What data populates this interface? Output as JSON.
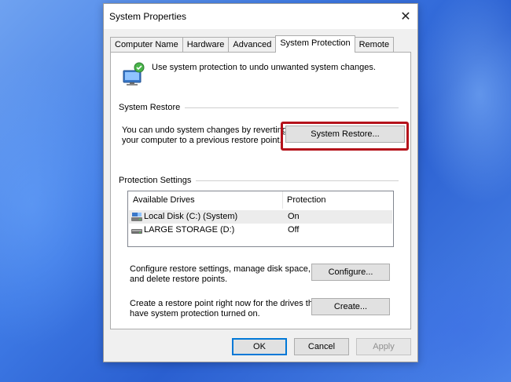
{
  "window": {
    "title": "System Properties",
    "close_glyph": "✕"
  },
  "tabs": [
    {
      "label": "Computer Name"
    },
    {
      "label": "Hardware"
    },
    {
      "label": "Advanced"
    },
    {
      "label": "System Protection",
      "active": true
    },
    {
      "label": "Remote"
    }
  ],
  "intro": {
    "icon": "system-protection-icon",
    "text": "Use system protection to undo unwanted system changes."
  },
  "system_restore": {
    "header": "System Restore",
    "description_line1": "You can undo system changes by reverting",
    "description_line2": "your computer to a previous restore point.",
    "button_label": "System Restore...",
    "highlight_color": "#b5121b"
  },
  "protection_settings": {
    "header": "Protection Settings",
    "columns": [
      "Available Drives",
      "Protection"
    ],
    "drives": [
      {
        "name": "Local Disk (C:) (System)",
        "protection": "On",
        "icon": "system-drive-icon",
        "selected": true
      },
      {
        "name": "LARGE STORAGE (D:)",
        "protection": "Off",
        "icon": "drive-icon",
        "selected": false
      }
    ]
  },
  "configure": {
    "text_line1": "Configure restore settings, manage disk space,",
    "text_line2": "and delete restore points.",
    "button_label": "Configure..."
  },
  "create": {
    "text_line1": "Create a restore point right now for the drives that",
    "text_line2": "have system protection turned on.",
    "button_label": "Create..."
  },
  "footer": {
    "ok_label": "OK",
    "cancel_label": "Cancel",
    "apply_label": "Apply",
    "apply_enabled": false
  }
}
